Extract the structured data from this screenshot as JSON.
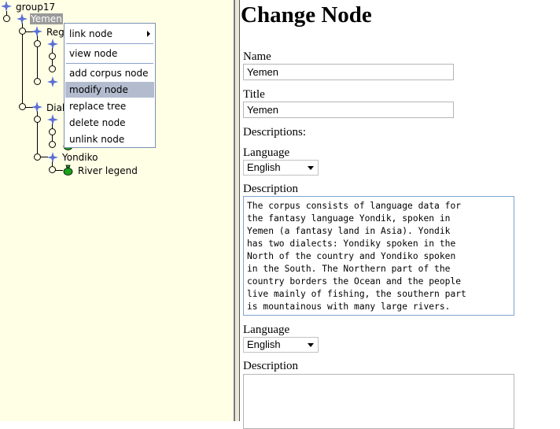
{
  "tree": {
    "root": "group17",
    "selected": "Yemen",
    "regions_partial": "Reg",
    "dialects_partial": "Dial",
    "yondiko": "Yondiko",
    "river_legend": "River legend"
  },
  "context_menu": {
    "items": [
      {
        "label": "link node"
      },
      {
        "label": "view node"
      },
      {
        "label": "add corpus node"
      },
      {
        "label": "modify node"
      },
      {
        "label": "replace tree"
      },
      {
        "label": "delete node"
      },
      {
        "label": "unlink node"
      }
    ]
  },
  "form": {
    "title": "Change Node",
    "name_label": "Name",
    "name_value": "Yemen",
    "title_label": "Title",
    "title_value": "Yemen",
    "descriptions_label": "Descriptions:",
    "language_label": "Language",
    "language_value": "English",
    "description_label": "Description",
    "description_text": "The corpus consists of language data for\nthe fantasy language Yondik, spoken in\nYemen (a fantasy land in Asia). Yondik\nhas two dialects: Yondiky spoken in the\nNorth of the country and Yondiko spoken\nin the South. The Northern part of the\ncountry borders the Ocean and the people\nlive mainly of fishing, the southern part\nis mountainous with many large rivers.",
    "language2_label": "Language",
    "language2_value": "English",
    "description2_label": "Description",
    "description2_text": ""
  },
  "colors": {
    "tree_background": "#ffffe6",
    "menu_highlight": "#b3bccf",
    "node_icon": "#5a6fd6",
    "corpus_icon": "#1aa21a"
  },
  "icons": {
    "tree_node": "star-node-icon",
    "corpus": "corpus-bag-icon",
    "submenu": "chevron-right-icon",
    "dropdown": "chevron-down-icon"
  }
}
